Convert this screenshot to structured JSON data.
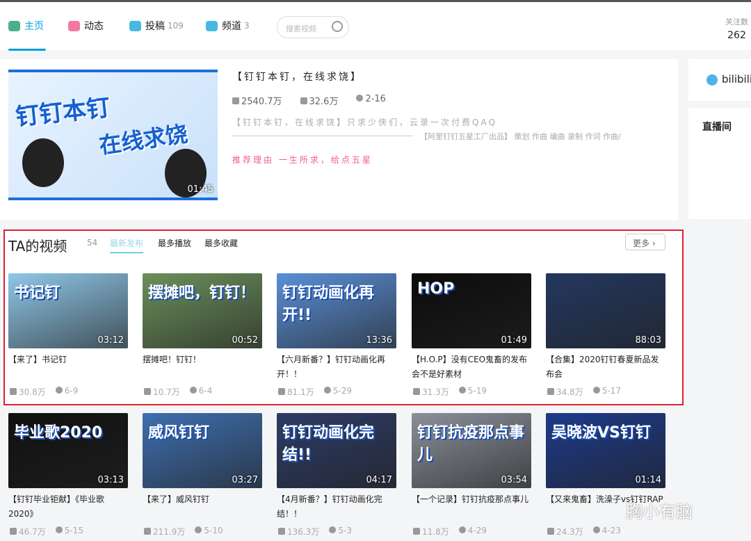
{
  "nav": {
    "items": [
      {
        "label": "主页",
        "count": ""
      },
      {
        "label": "动态",
        "count": ""
      },
      {
        "label": "投稿",
        "count": "109"
      },
      {
        "label": "频道",
        "count": "3"
      }
    ],
    "search_placeholder": "搜索视频",
    "fans_label": "关注数",
    "fans_count": "262"
  },
  "featured": {
    "title": "【钉钉本钉，在线求饶】",
    "thumb_text1": "钉钉本钉",
    "thumb_text2": "在线求饶",
    "duration": "01:45",
    "plays": "2540.7万",
    "danmaku": "32.6万",
    "date": "2-16",
    "desc": "【钉钉本钉，在线求饶】只求少侠们，云录一次付费QAQ",
    "credits": "【阿里钉钉五星工厂出品】 策划 作曲 编曲 录制 作词 作曲/",
    "reason": "推荐理由 一生所求，给点五星"
  },
  "side": {
    "brand": "bilibili",
    "live": "直播间"
  },
  "videos": {
    "title": "TA的视频",
    "count": "54",
    "tabs": [
      "最新发布",
      "最多播放",
      "最多收藏"
    ],
    "more": "更多",
    "items": [
      {
        "title": "【来了】书记钉",
        "overlay": "书记钉",
        "duration": "03:12",
        "plays": "30.8万",
        "date": "6-9",
        "color": "#8fc7e8"
      },
      {
        "title": "摆摊吧！钉钉！",
        "overlay": "摆摊吧，钉钉！",
        "duration": "00:52",
        "plays": "10.7万",
        "date": "6-4",
        "color": "#6b8f5a"
      },
      {
        "title": "【六月新番？】钉钉动画化再开！！",
        "overlay": "钉钉动画化再开!!",
        "duration": "13:36",
        "plays": "81.1万",
        "date": "5-29",
        "color": "#5a8fd6"
      },
      {
        "title": "【H.O.P】没有CEO鬼畜的发布会不是好素材",
        "overlay": "HOP",
        "duration": "01:49",
        "plays": "31.3万",
        "date": "5-19",
        "color": "#0c0c0c"
      },
      {
        "title": "【合集】2020钉钉春夏新品发布会",
        "overlay": "",
        "duration": "88:03",
        "plays": "34.8万",
        "date": "5-17",
        "color": "#23375f"
      },
      {
        "title": "【钉钉毕业钜献】《毕业歌2020》",
        "overlay": "毕业歌2020",
        "duration": "03:13",
        "plays": "46.7万",
        "date": "5-15",
        "color": "#111111"
      },
      {
        "title": "【来了】威风钉钉",
        "overlay": "威风钉钉",
        "duration": "03:27",
        "plays": "211.9万",
        "date": "5-10",
        "color": "#3e6fb0"
      },
      {
        "title": "【4月新番？】钉钉动画化完结！！",
        "overlay": "钉钉动画化完结!!",
        "duration": "04:17",
        "plays": "136.3万",
        "date": "5-3",
        "color": "#2d3b66"
      },
      {
        "title": "【一个记录】钉钉抗疫那点事儿",
        "overlay": "钉钉抗疫那点事儿",
        "duration": "03:54",
        "plays": "11.8万",
        "date": "4-29",
        "color": "#8a8f99"
      },
      {
        "title": "【又来鬼畜】洗澡子vs钉钉RAP",
        "overlay": "吴晓波VS钉钉",
        "duration": "01:14",
        "plays": "24.3万",
        "date": "4-23",
        "color": "#1d3a8a"
      }
    ]
  },
  "watermark": "胸小有脑"
}
